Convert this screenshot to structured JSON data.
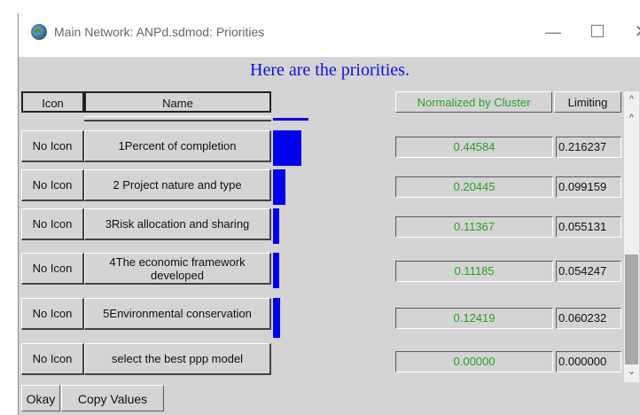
{
  "window": {
    "title": "Main Network: ANPd.sdmod: Priorities",
    "minimize": "—",
    "close": "✕"
  },
  "heading": "Here are the priorities.",
  "columns": {
    "icon": "Icon",
    "name": "Name",
    "normalized": "Normalized by Cluster",
    "limiting": "Limiting"
  },
  "rows": [
    {
      "icon": "No Icon",
      "name": "1Percent of completion",
      "normalized": "0.44584",
      "limiting": "0.216237"
    },
    {
      "icon": "No Icon",
      "name": "2 Project nature and type",
      "normalized": "0.20445",
      "limiting": "0.099159"
    },
    {
      "icon": "No Icon",
      "name": "3Risk allocation and sharing",
      "normalized": "0.11367",
      "limiting": "0.055131"
    },
    {
      "icon": "No Icon",
      "name": "4The economic framework developed",
      "normalized": "0.11185",
      "limiting": "0.054247"
    },
    {
      "icon": "No Icon",
      "name": "5Environmental conservation",
      "normalized": "0.12419",
      "limiting": "0.060232"
    },
    {
      "icon": "No Icon",
      "name": "select the best ppp model",
      "normalized": "0.00000",
      "limiting": "0.000000"
    }
  ],
  "buttons": {
    "okay": "Okay",
    "copy_values": "Copy Values"
  },
  "colors": {
    "heading": "#1010e6",
    "normalized_text": "#2aa02a",
    "bar": "#0000ee"
  }
}
